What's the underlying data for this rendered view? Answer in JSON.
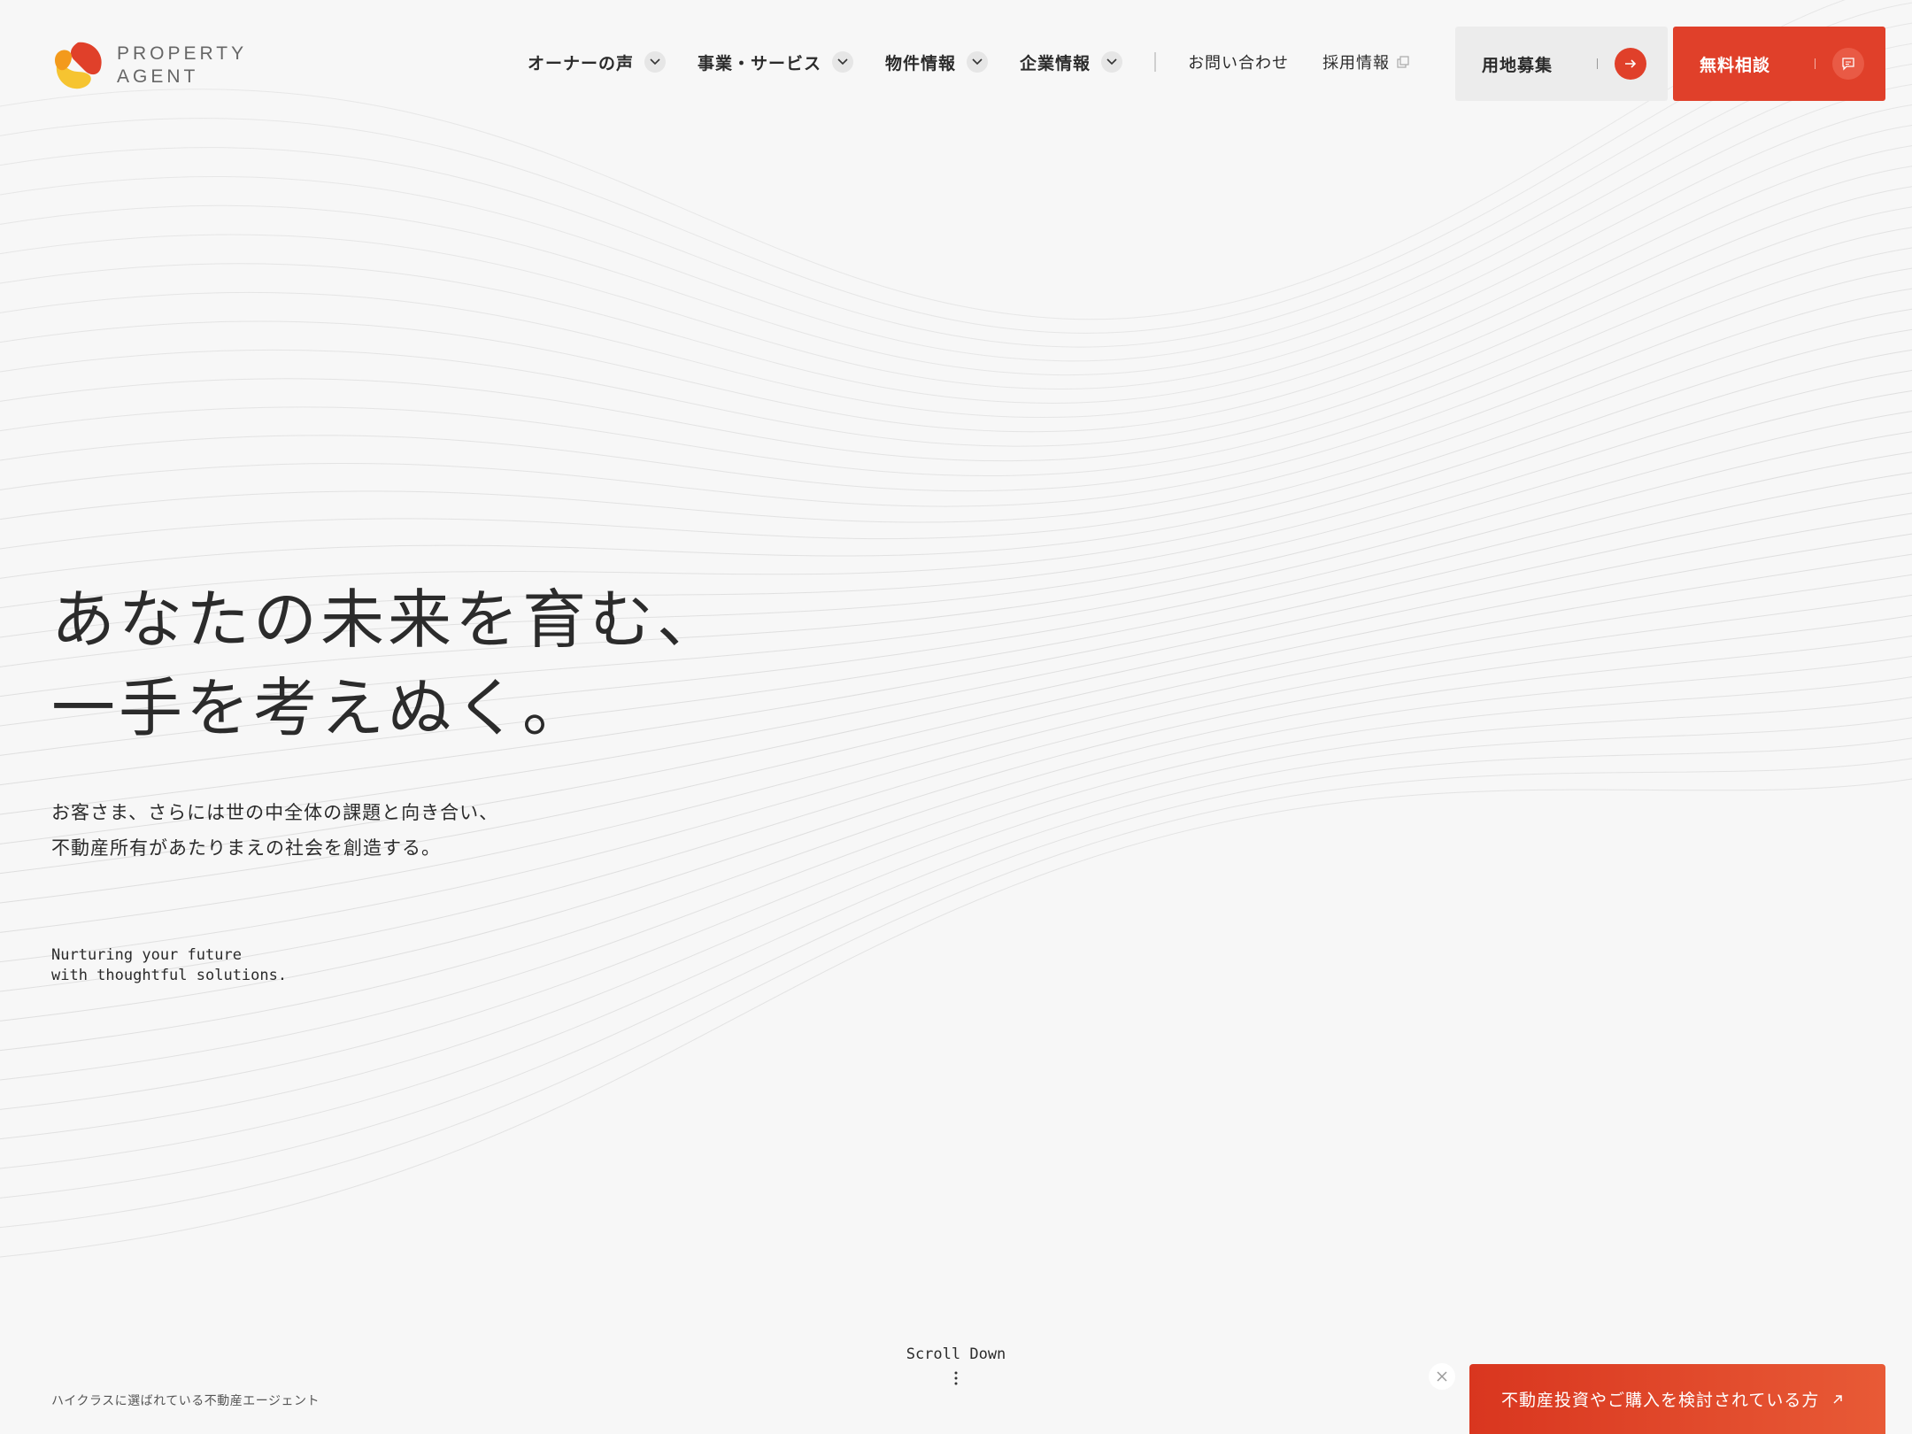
{
  "brand": {
    "line1": "PROPERTY",
    "line2": "AGENT",
    "colors": {
      "red": "#e0402a",
      "orange": "#f39a1c",
      "yellow": "#f6c431"
    }
  },
  "nav": {
    "items": [
      {
        "label": "オーナーの声",
        "icon": "chevron-down-icon"
      },
      {
        "label": "事業・サービス",
        "icon": "chevron-down-icon"
      },
      {
        "label": "物件情報",
        "icon": "chevron-down-icon"
      },
      {
        "label": "企業情報",
        "icon": "chevron-down-icon"
      }
    ],
    "links": [
      {
        "label": "お問い合わせ"
      },
      {
        "label": "採用情報",
        "icon": "external-link-icon"
      }
    ]
  },
  "cta": {
    "land_label": "用地募集",
    "land_icon": "arrow-right-icon",
    "consult_label": "無料相談",
    "consult_icon": "chat-icon",
    "accent": "#e0402a"
  },
  "hero": {
    "title_line1": "あなたの未来を育む、",
    "title_line2": "一手を考えぬく。",
    "sub_line1": "お客さま、さらには世の中全体の課題と向き合い、",
    "sub_line2": "不動産所有があたりまえの社会を創造する。",
    "en_line1": "Nurturing your future",
    "en_line2": "with thoughtful solutions."
  },
  "footer": {
    "scroll_label": "Scroll Down",
    "tagline": "ハイクラスに選ばれている不動産エージェント",
    "promo_label": "不動産投資やご購入を検討されている方",
    "promo_icon": "arrow-up-right-icon",
    "close_icon": "close-icon"
  }
}
